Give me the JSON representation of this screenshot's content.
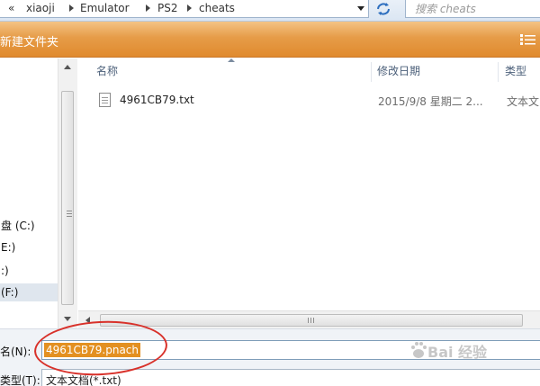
{
  "address_bar": {
    "crumbs": [
      "«",
      "xiaoji",
      "Emulator",
      "PS2",
      "cheats"
    ],
    "search_placeholder": "搜索 cheats"
  },
  "toolbar": {
    "new_folder_label": "新建文件夹",
    "view_icon": "view-options-icon"
  },
  "nav_pane": {
    "items": [
      {
        "label": "盘 (C:)",
        "selected": false
      },
      {
        "label": "E:)",
        "selected": false
      },
      {
        "label": ":)",
        "selected": false
      },
      {
        "label": "(F:)",
        "selected": true
      }
    ]
  },
  "file_list": {
    "columns": [
      "名称",
      "修改日期",
      "类型"
    ],
    "rows": [
      {
        "name": "4961CB79.txt",
        "date": "2015/9/8 星期二 2...",
        "type": "文本文"
      }
    ]
  },
  "save_form": {
    "filename_label": "名(N):",
    "filename_value": "4961CB79.pnach",
    "filetype_label": "类型(T):",
    "filetype_value": "文本文档(*.txt)"
  },
  "watermark": {
    "text": "Bai 经验"
  },
  "colors": {
    "toolbar_orange": "#e69c48",
    "selection_orange": "#e39021",
    "annotation_red": "#d8312a"
  }
}
